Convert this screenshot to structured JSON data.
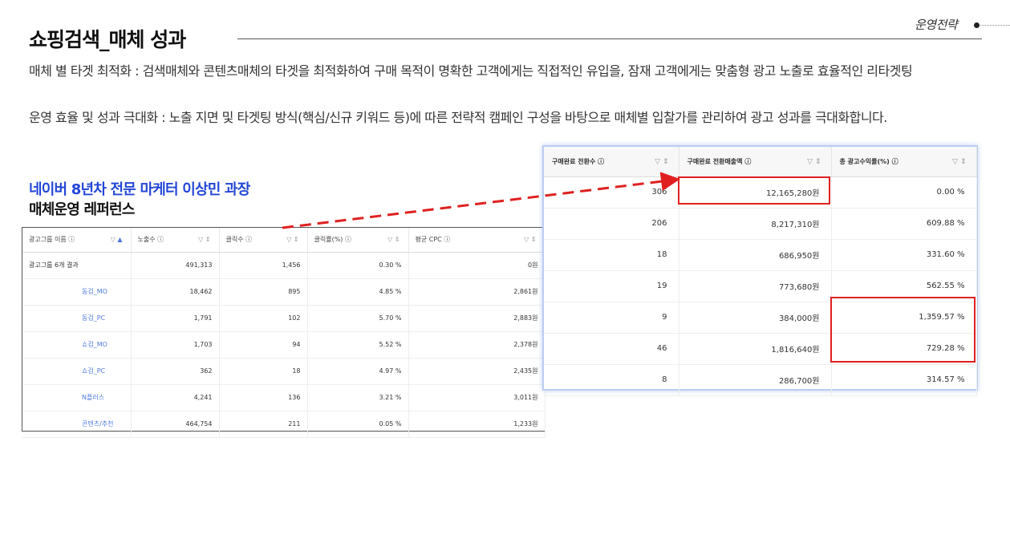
{
  "header": {
    "title": "쇼핑검색_매체 성과",
    "section_label": "운영전략"
  },
  "description": {
    "line1": "매체 별 타겟 최적화 : 검색매체와 콘텐츠매체의 타겟을 최적화하여 구매 목적이 명확한 고객에게는 직접적인 유입을, 잠재 고객에게는 맞춤형 광고 노출로 효율적인 리타겟팅",
    "line2": "운영 효율 및 성과 극대화 : 노출 지면 및 타겟팅 방식(핵심/신규 키워드 등)에 따른 전략적 캠페인 구성을 바탕으로 매체별 입찰가를 관리하여 광고 성과를 극대화합니다."
  },
  "author": {
    "title": "네이버 8년차 전문 마케터 이상민 과장",
    "subtitle": "매체운영 레퍼런스"
  },
  "left_table": {
    "headers": [
      "광고그룹 이름",
      "노출수",
      "클릭수",
      "클릭률(%)",
      "평균 CPC"
    ],
    "total_row": [
      "광고그룹 6개 결과",
      "491,313",
      "1,456",
      "0.30 %",
      "0원"
    ],
    "rows": [
      [
        "동검_MO",
        "18,462",
        "895",
        "4.85 %",
        "2,861원"
      ],
      [
        "동검_PC",
        "1,791",
        "102",
        "5.70 %",
        "2,883원"
      ],
      [
        "쇼검_MO",
        "1,703",
        "94",
        "5.52 %",
        "2,378원"
      ],
      [
        "쇼검_PC",
        "362",
        "18",
        "4.97 %",
        "2,435원"
      ],
      [
        "N플러스",
        "4,241",
        "136",
        "3.21 %",
        "3,011원"
      ],
      [
        "콘텐츠/추천",
        "464,754",
        "211",
        "0.05 %",
        "1,233원"
      ]
    ]
  },
  "right_table": {
    "headers": [
      "구매완료 전환수",
      "구매완료 전환매출액",
      "총 광고수익률(%)"
    ],
    "rows": [
      [
        "306",
        "12,165,280원",
        "0.00 %"
      ],
      [
        "206",
        "8,217,310원",
        "609.88 %"
      ],
      [
        "18",
        "686,950원",
        "331.60 %"
      ],
      [
        "19",
        "773,680원",
        "562.55 %"
      ],
      [
        "9",
        "384,000원",
        "1,359.57 %"
      ],
      [
        "46",
        "1,816,640원",
        "729.28 %"
      ],
      [
        "8",
        "286,700원",
        "314.57 %"
      ]
    ]
  },
  "icons": {
    "info": "info-icon",
    "filter": "filter-icon",
    "sort": "sort-icon"
  },
  "colors": {
    "accent_blue": "#2346d6",
    "highlight_red": "#e02020",
    "link_blue": "#4e7be0"
  }
}
